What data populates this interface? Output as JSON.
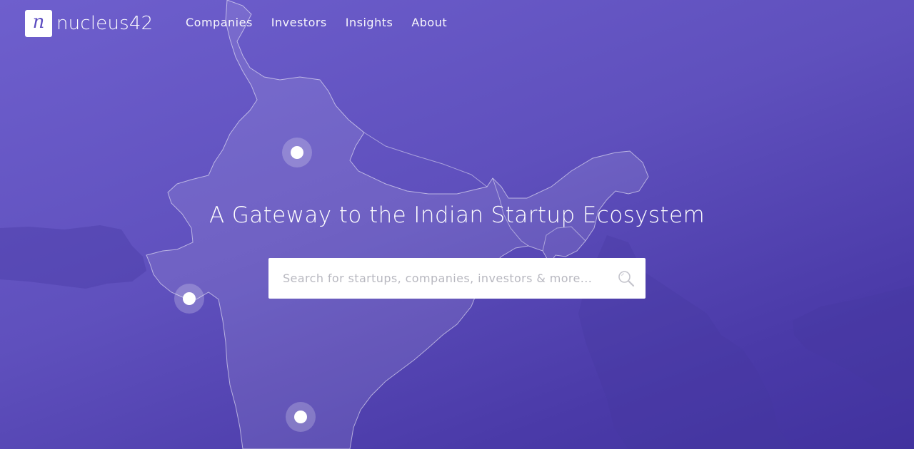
{
  "brand": {
    "logo_letter": "n",
    "name": "nucleus42"
  },
  "nav": {
    "items": [
      {
        "label": "Companies"
      },
      {
        "label": "Investors"
      },
      {
        "label": "Insights"
      },
      {
        "label": "About"
      }
    ]
  },
  "hero": {
    "title": "A Gateway to the Indian Startup Ecosystem"
  },
  "search": {
    "placeholder": "Search for startups, companies, investors & more...",
    "icon": "magnifier-icon"
  },
  "map": {
    "markers": [
      {
        "city": "delhi"
      },
      {
        "city": "ahmedabad"
      },
      {
        "city": "bengaluru"
      }
    ]
  },
  "colors": {
    "background_start": "#6e5fcd",
    "background_end": "#41329e",
    "accent": "#5b4cc0",
    "text": "#ffffff"
  }
}
